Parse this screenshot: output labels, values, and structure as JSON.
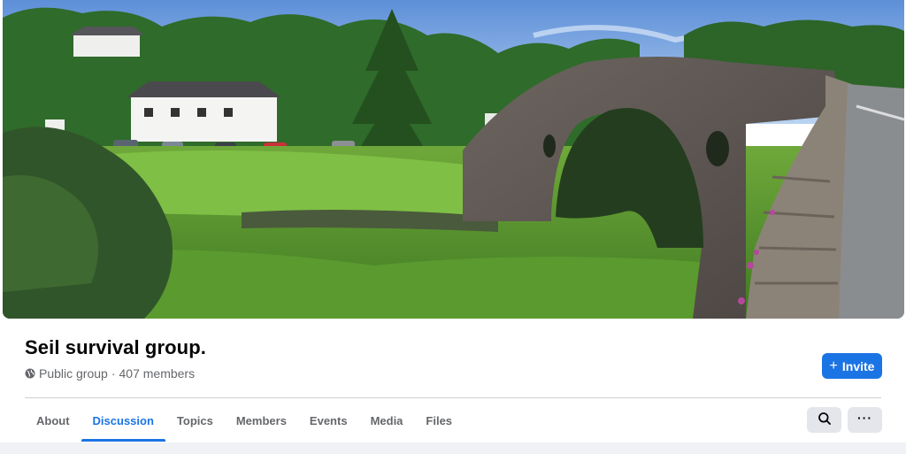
{
  "group": {
    "name": "Seil survival group.",
    "privacy": "Public group",
    "separator": "·",
    "members": "407 members",
    "globe_icon": "globe-icon"
  },
  "actions": {
    "invite_label": "Invite",
    "invite_icon": "plus-icon",
    "search_icon": "search-icon",
    "more_label": "···"
  },
  "tabs": [
    {
      "label": "About",
      "active": false
    },
    {
      "label": "Discussion",
      "active": true
    },
    {
      "label": "Topics",
      "active": false
    },
    {
      "label": "Members",
      "active": false
    },
    {
      "label": "Events",
      "active": false
    },
    {
      "label": "Media",
      "active": false
    },
    {
      "label": "Files",
      "active": false
    }
  ],
  "colors": {
    "accent": "#1b74e4",
    "text_primary": "#050505",
    "text_secondary": "#65676b",
    "button_gray": "#e4e6eb",
    "page_background": "#f0f2f5"
  }
}
